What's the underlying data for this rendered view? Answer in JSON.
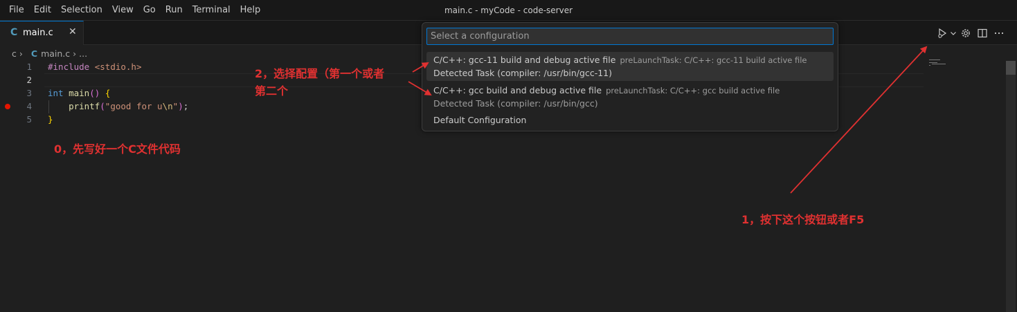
{
  "menubar": {
    "items": [
      "File",
      "Edit",
      "Selection",
      "View",
      "Go",
      "Run",
      "Terminal",
      "Help"
    ],
    "window_title": "main.c - myCode - code-server"
  },
  "tab": {
    "icon_label": "C",
    "label": "main.c",
    "close_glyph": "✕"
  },
  "breadcrumb": {
    "folder": "c",
    "file_icon": "C",
    "file": "main.c",
    "symbol": "..."
  },
  "editor": {
    "line_numbers": [
      "1",
      "2",
      "3",
      "4",
      "5"
    ],
    "lines": [
      {
        "directive": "#include",
        "header": "<stdio.h>"
      },
      {},
      {
        "type": "int",
        "name": "main",
        "parens": "()",
        "brace": "{"
      },
      {
        "fn": "printf",
        "open": "(",
        "str_a": "\"good for u",
        "esc": "\\n",
        "str_b": "\"",
        "close": ")",
        "semi": ";"
      },
      {
        "brace": "}"
      }
    ],
    "breakpoint_line": 4
  },
  "quick_pick": {
    "placeholder": "Select a configuration",
    "items": [
      {
        "label": "C/C++: gcc-11 build and debug active file",
        "description": "preLaunchTask: C/C++: gcc-11 build active file",
        "detail": "Detected Task (compiler: /usr/bin/gcc-11)"
      },
      {
        "label": "C/C++: gcc build and debug active file",
        "description": "preLaunchTask: C/C++: gcc build active file",
        "detail": "Detected Task (compiler: /usr/bin/gcc)"
      },
      {
        "label": "Default Configuration"
      }
    ]
  },
  "annotations": {
    "step0": "0，先写好一个C文件代码",
    "step1": "1，按下这个按钮或者F5",
    "step2_line1": "2，选择配置（第一个或者",
    "step2_line2": "第二个"
  },
  "icons": {
    "run_debug": "run-debug-icon",
    "dropdown": "chevron-down-icon",
    "settings": "gear-icon",
    "split": "split-editor-icon",
    "more": "more-actions-icon"
  },
  "colors": {
    "accent": "#0078d4",
    "annotation": "#e03131",
    "breakpoint": "#e51400"
  }
}
